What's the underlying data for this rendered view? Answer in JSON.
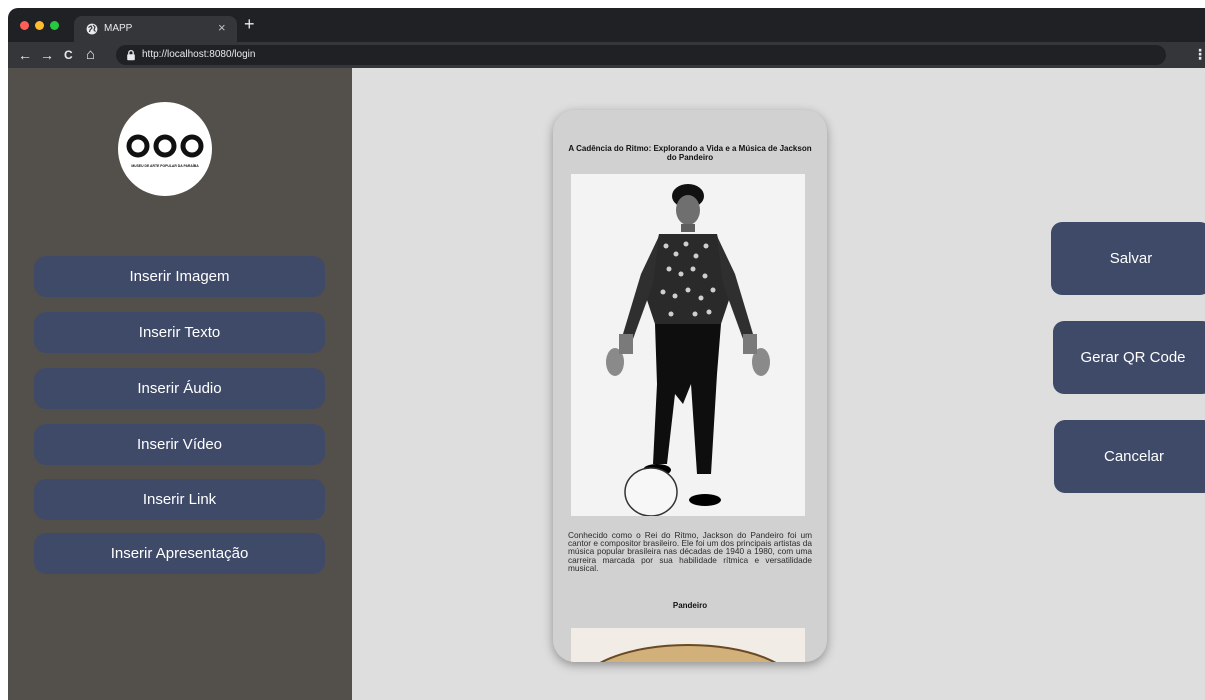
{
  "browser": {
    "tab_title": "MAPP",
    "tab_close": "×",
    "new_tab": "+",
    "url": "http://localhost:8080/login",
    "nav": {
      "back": "←",
      "forward": "→",
      "reload": "C",
      "home": "⌂",
      "menu": "⋮"
    },
    "traffic_colors": [
      "#ff5f57",
      "#febc2e",
      "#28c840"
    ]
  },
  "sidebar": {
    "logo_caption": "MUSEU DE ARTE POPULAR DA PARAÍBA",
    "buttons": [
      "Inserir Imagem",
      "Inserir Texto",
      "Inserir Áudio",
      "Inserir Vídeo",
      "Inserir Link",
      "Inserir Apresentação"
    ]
  },
  "preview": {
    "title": "A Cadência do Ritmo: Explorando a Vida e a Música de Jackson do Pandeiro",
    "description": "Conhecido como o Rei do Ritmo, Jackson do Pandeiro foi um cantor e compositor brasileiro. Ele foi um dos principais artistas da música popular brasileira nas décadas de 1940 a 1980, com uma carreira marcada por sua habilidade rítmica e versatilidade musical.",
    "caption": "Pandeiro"
  },
  "actions": {
    "save": "Salvar",
    "qr": "Gerar QR Code",
    "cancel": "Cancelar"
  },
  "colors": {
    "sidebar_bg": "#534f4b",
    "button_bg": "#3f4a69",
    "canvas_bg": "#dedede",
    "phone_bg": "#d1d1d1"
  }
}
